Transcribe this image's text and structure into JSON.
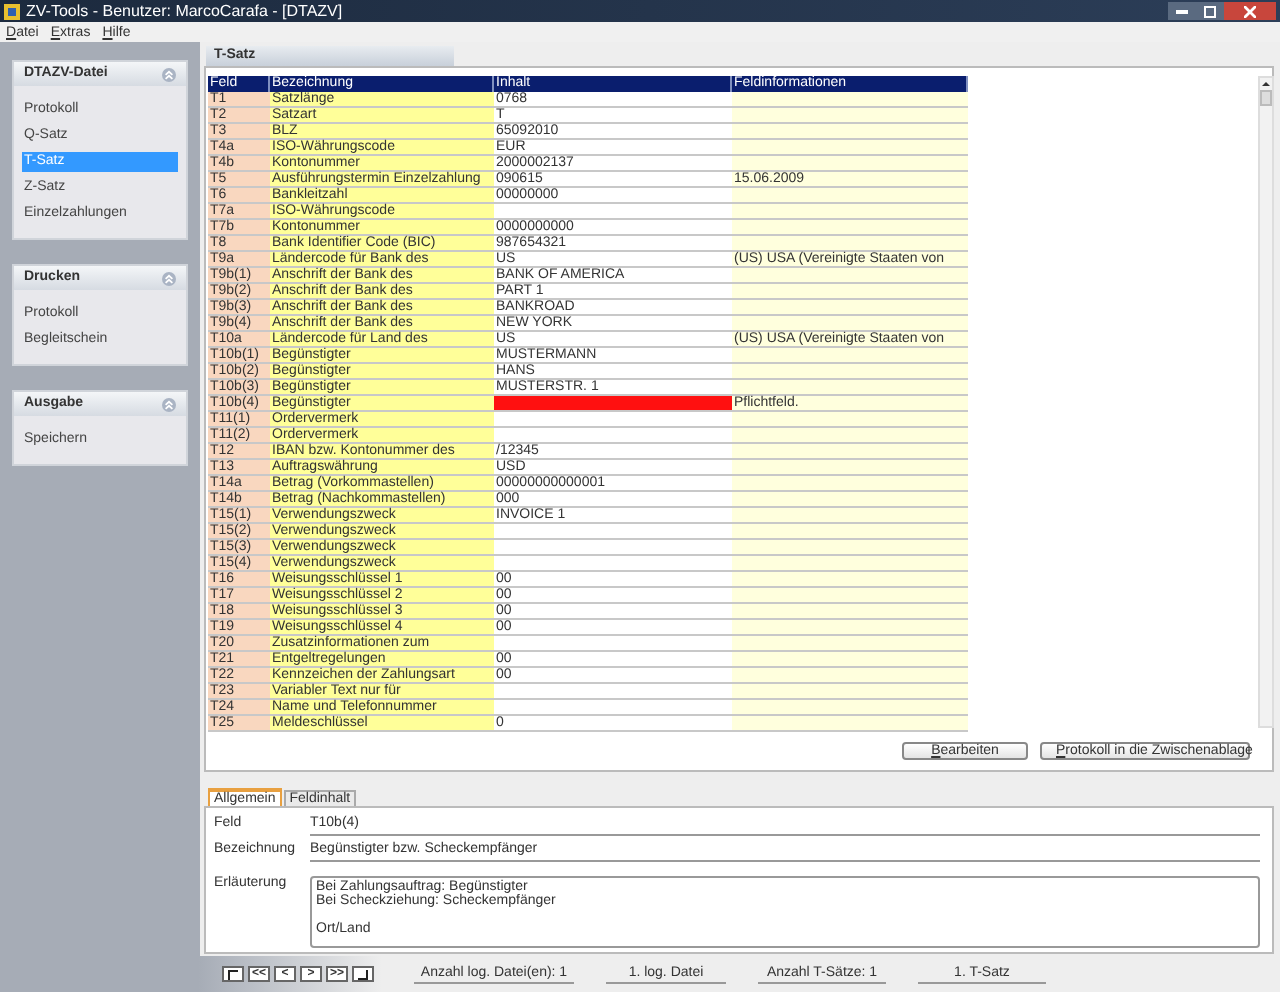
{
  "window": {
    "title": "ZV-Tools - Benutzer: MarcoCarafa - [DTAZV]"
  },
  "menu": [
    "Datei",
    "Extras",
    "Hilfe"
  ],
  "sidebar": [
    {
      "title": "DTAZV-Datei",
      "items": [
        {
          "label": "Protokoll",
          "selected": false
        },
        {
          "label": "Q-Satz",
          "selected": false
        },
        {
          "label": "T-Satz",
          "selected": true
        },
        {
          "label": "Z-Satz",
          "selected": false
        },
        {
          "label": "Einzelzahlungen",
          "selected": false
        }
      ]
    },
    {
      "title": "Drucken",
      "items": [
        {
          "label": "Protokoll",
          "selected": false
        },
        {
          "label": "Begleitschein",
          "selected": false
        }
      ]
    },
    {
      "title": "Ausgabe",
      "items": [
        {
          "label": "Speichern",
          "selected": false
        }
      ]
    }
  ],
  "panel_title": "T-Satz",
  "table": {
    "columns": [
      "Feld",
      "Bezeichnung",
      "Inhalt",
      "Feldinformationen"
    ],
    "rows": [
      {
        "field": "T1",
        "name": "Satzlänge",
        "value": "0768",
        "invalid": false
      },
      {
        "field": "T2",
        "name": "Satzart",
        "value": "T",
        "invalid": false
      },
      {
        "field": "T3",
        "name": "BLZ",
        "value": "65092010",
        "invalid": false
      },
      {
        "field": "T4a",
        "name": "ISO-Währungscode",
        "value": "EUR",
        "invalid": false
      },
      {
        "field": "T4b",
        "name": "Kontonummer",
        "value": "2000002137",
        "invalid": false
      },
      {
        "field": "T5",
        "name": "Ausführungstermin Einzelzahlung",
        "value": "090615",
        "info": "15.06.2009",
        "invalid": false
      },
      {
        "field": "T6",
        "name": "Bankleitzahl",
        "value": "00000000",
        "invalid": false
      },
      {
        "field": "T7a",
        "name": "ISO-Währungscode",
        "invalid": false
      },
      {
        "field": "T7b",
        "name": "Kontonummer",
        "value": "0000000000",
        "invalid": false
      },
      {
        "field": "T8",
        "name": "Bank Identifier Code (BIC)",
        "value": "987654321",
        "invalid": false
      },
      {
        "field": "T9a",
        "name": "Ländercode für Bank des",
        "value": "US",
        "info": "(US) USA (Vereinigte Staaten von",
        "invalid": false
      },
      {
        "field": "T9b(1)",
        "name": "Anschrift der Bank des",
        "value": "BANK OF AMERICA",
        "invalid": false
      },
      {
        "field": "T9b(2)",
        "name": "Anschrift der Bank des",
        "value": "PART 1",
        "invalid": false
      },
      {
        "field": "T9b(3)",
        "name": "Anschrift der Bank des",
        "value": "BANKROAD",
        "invalid": false
      },
      {
        "field": "T9b(4)",
        "name": "Anschrift der Bank des",
        "value": "NEW YORK",
        "invalid": false
      },
      {
        "field": "T10a",
        "name": "Ländercode für Land des",
        "value": "US",
        "info": "(US) USA (Vereinigte Staaten von",
        "invalid": false
      },
      {
        "field": "T10b(1)",
        "name": "Begünstigter",
        "value": "MUSTERMANN",
        "invalid": false
      },
      {
        "field": "T10b(2)",
        "name": "Begünstigter",
        "value": "HANS",
        "invalid": false
      },
      {
        "field": "T10b(3)",
        "name": "Begünstigter",
        "value": "MUSTERSTR. 1",
        "invalid": false
      },
      {
        "field": "T10b(4)",
        "name": "Begünstigter",
        "info": "Pflichtfeld.",
        "invalid": true
      },
      {
        "field": "T11(1)",
        "name": "Ordervermerk",
        "invalid": false
      },
      {
        "field": "T11(2)",
        "name": "Ordervermerk",
        "invalid": false
      },
      {
        "field": "T12",
        "name": "IBAN bzw. Kontonummer des",
        "value": "/12345",
        "invalid": false
      },
      {
        "field": "T13",
        "name": "Auftragswährung",
        "value": "USD",
        "invalid": false
      },
      {
        "field": "T14a",
        "name": "Betrag (Vorkommastellen)",
        "value": "00000000000001",
        "invalid": false
      },
      {
        "field": "T14b",
        "name": "Betrag (Nachkommastellen)",
        "value": "000",
        "invalid": false
      },
      {
        "field": "T15(1)",
        "name": "Verwendungszweck",
        "value": "INVOICE 1",
        "invalid": false
      },
      {
        "field": "T15(2)",
        "name": "Verwendungszweck",
        "invalid": false
      },
      {
        "field": "T15(3)",
        "name": "Verwendungszweck",
        "invalid": false
      },
      {
        "field": "T15(4)",
        "name": "Verwendungszweck",
        "invalid": false
      },
      {
        "field": "T16",
        "name": "Weisungsschlüssel 1",
        "value": "00",
        "invalid": false
      },
      {
        "field": "T17",
        "name": "Weisungsschlüssel 2",
        "value": "00",
        "invalid": false
      },
      {
        "field": "T18",
        "name": "Weisungsschlüssel 3",
        "value": "00",
        "invalid": false
      },
      {
        "field": "T19",
        "name": "Weisungsschlüssel 4",
        "value": "00",
        "invalid": false
      },
      {
        "field": "T20",
        "name": "Zusatzinformationen zum",
        "invalid": false
      },
      {
        "field": "T21",
        "name": "Entgeltregelungen",
        "value": "00",
        "invalid": false
      },
      {
        "field": "T22",
        "name": "Kennzeichen der Zahlungsart",
        "value": "00",
        "invalid": false
      },
      {
        "field": "T23",
        "name": "Variabler Text nur für",
        "invalid": false
      },
      {
        "field": "T24",
        "name": "Name und Telefonnummer",
        "invalid": false
      },
      {
        "field": "T25",
        "name": "Meldeschlüssel",
        "value": "0",
        "invalid": false
      }
    ]
  },
  "buttons": [
    "Bearbeiten",
    "Protokoll in die Zwischenablage"
  ],
  "detail_tabs": [
    {
      "label": "Allgemein",
      "selected": true
    },
    {
      "label": "Feldinhalt",
      "selected": false
    }
  ],
  "detail": {
    "fields": [
      {
        "label": "Feld",
        "value": "T10b(4)"
      },
      {
        "label": "Bezeichnung",
        "value": "Begünstigter bzw. Scheckempfänger"
      }
    ],
    "note_label": "Erläuterung",
    "note_paragraphs": [
      [
        "Bei Zahlungsauftrag: Begünstigter",
        "Bei Scheckziehung: Scheckempfänger"
      ],
      [
        "Ort/Land"
      ]
    ]
  },
  "nav_buttons": [
    "<<",
    "<",
    ">",
    ">>"
  ],
  "status_bar": [
    "Anzahl log. Datei(en): 1",
    "1. log. Datei",
    "Anzahl T-Sätze: 1",
    "1. T-Satz"
  ]
}
